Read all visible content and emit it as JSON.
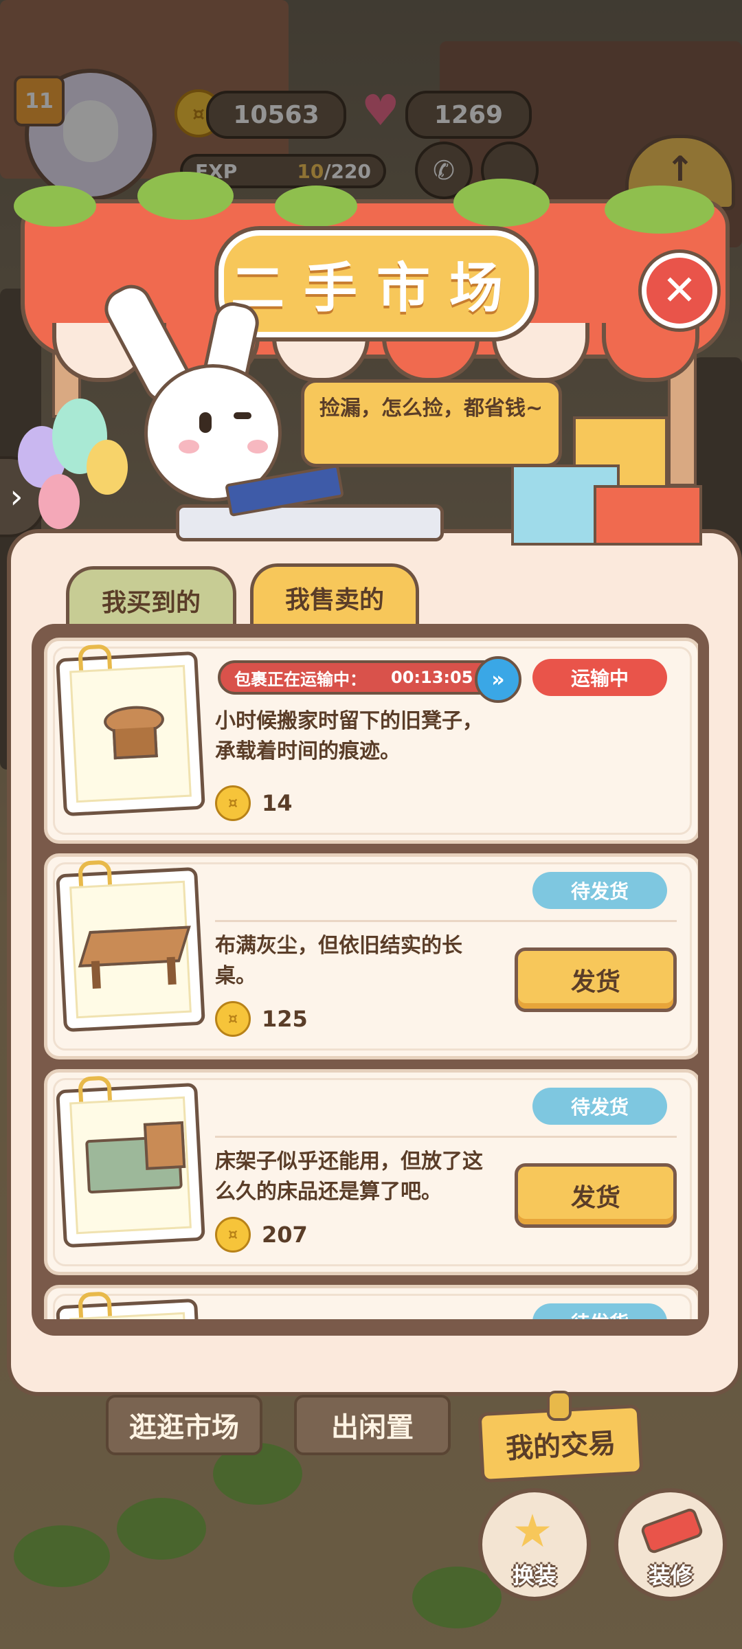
{
  "hud": {
    "level": "11",
    "coins": "10563",
    "hearts": "1269",
    "exp_label": "EXP",
    "exp_current": "10",
    "exp_total": "/220"
  },
  "dialog": {
    "title": "二手市场",
    "close_icon": "close-icon",
    "speech": "捡漏，怎么捡，都省钱~",
    "tabs": [
      {
        "label": "我买到的",
        "active": false
      },
      {
        "label": "我售卖的",
        "active": true
      }
    ],
    "items": [
      {
        "transit_label": "包裹正在运输中：",
        "timer": "00:13:05",
        "status": "运输中",
        "description": "小时候搬家时留下的旧凳子，承载着时间的痕迹。",
        "price": "14"
      },
      {
        "status": "待发货",
        "description": "布满灰尘，但依旧结实的长桌。",
        "price": "125",
        "action": "发货"
      },
      {
        "status": "待发货",
        "description": "床架子似乎还能用，但放了这么久的床品还是算了吧。",
        "price": "207",
        "action": "发货"
      },
      {
        "status": "待发货"
      }
    ]
  },
  "bottom": {
    "browse_market": "逛逛市场",
    "sell_idle": "出闲置",
    "my_trades": "我的交易",
    "dress_up": "换装",
    "decorate": "装修"
  },
  "colors": {
    "accent_yellow": "#f7c75a",
    "transit_red": "#e9544a",
    "pending_blue": "#7ec7e0",
    "border_brown": "#6e5342"
  }
}
